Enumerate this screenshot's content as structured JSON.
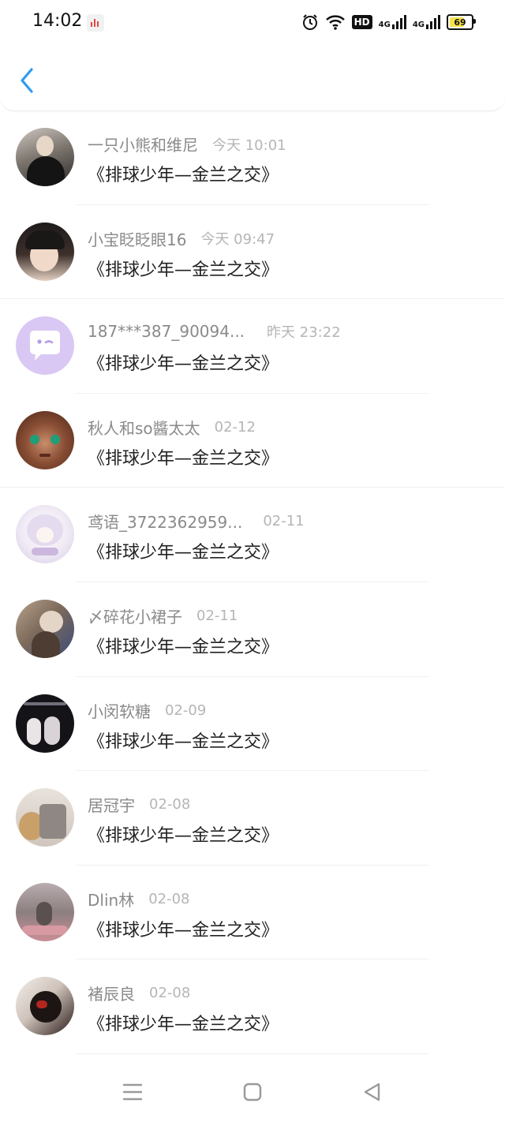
{
  "status_bar": {
    "time": "14:02",
    "network": "4G",
    "hd_label": "HD",
    "battery_level": "69"
  },
  "header": {
    "back_icon": "chevron-left-icon",
    "accent_color": "#2f9bf0"
  },
  "messages": [
    {
      "name": "一只小熊和维尼",
      "time": "今天 10:01",
      "text": "《排球少年—金兰之交》"
    },
    {
      "name": "小宝眨眨眼16",
      "time": "今天 09:47",
      "text": "《排球少年—金兰之交》"
    },
    {
      "name": "187***387_90094...",
      "time": "昨天 23:22",
      "text": "《排球少年—金兰之交》"
    },
    {
      "name": "秋人和so醬太太",
      "time": "02-12",
      "text": "《排球少年—金兰之交》"
    },
    {
      "name": "鸢语_3722362959...",
      "time": "02-11",
      "text": "《排球少年—金兰之交》"
    },
    {
      "name": "〆碎花小裙子",
      "time": "02-11",
      "text": "《排球少年—金兰之交》"
    },
    {
      "name": "小闵软糖",
      "time": "02-09",
      "text": "《排球少年—金兰之交》"
    },
    {
      "name": "居冠宇",
      "time": "02-08",
      "text": "《排球少年—金兰之交》"
    },
    {
      "name": "Dlin林",
      "time": "02-08",
      "text": "《排球少年—金兰之交》"
    },
    {
      "name": "褚辰良",
      "time": "02-08",
      "text": "《排球少年—金兰之交》"
    }
  ],
  "nav_bar": {
    "icons": [
      "menu-icon",
      "home-square-icon",
      "back-triangle-icon"
    ]
  }
}
